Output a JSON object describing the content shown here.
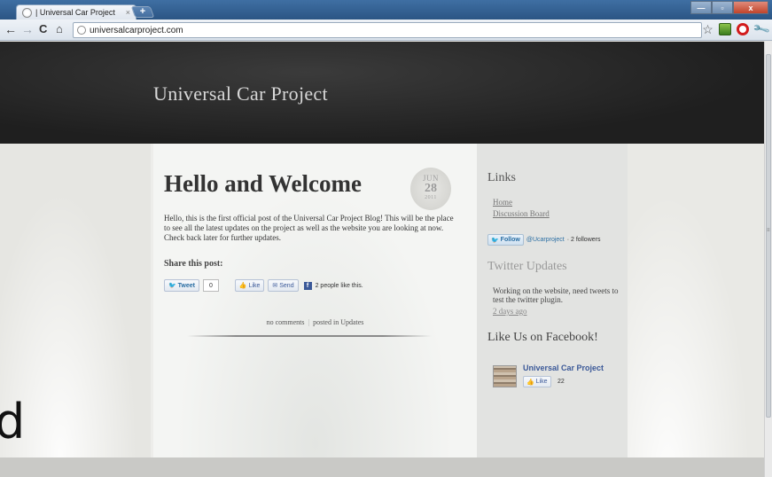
{
  "browser": {
    "tab_title": "| Universal Car Project",
    "tab_close": "×",
    "new_tab": "+",
    "url": "universalcarproject.com",
    "controls": {
      "back": "←",
      "forward": "→",
      "reload": "C",
      "home": "⌂",
      "star": "☆",
      "wrench": "🔧",
      "minimize": "—",
      "maximize": "▫",
      "close": "x"
    }
  },
  "site": {
    "title": "Universal Car Project"
  },
  "post": {
    "title": "Hello and Welcome",
    "date": {
      "month": "JUN",
      "day": "28",
      "year": "2011"
    },
    "body": "Hello, this is the first official post of the Universal Car Project Blog!  This will be the place to see all the latest updates on the project as well as the website you are looking at now.  Check back later for further updates.",
    "share_label": "Share this post:",
    "share": {
      "tweet_label": "Tweet",
      "tweet_count": "0",
      "like_label": "Like",
      "send_label": "Send",
      "fb_icon": "f",
      "likes_text": "2 people like this."
    },
    "meta": {
      "comments": "no comments",
      "separator": "|",
      "posted_in": "posted in",
      "category": "Updates"
    }
  },
  "sidebar": {
    "links_heading": "Links",
    "links": [
      "Home",
      "Discussion Board"
    ],
    "follow": {
      "button_label": "Follow",
      "handle": "@Ucarproject",
      "count": "· 2 followers"
    },
    "twitter_heading": "Twitter Updates",
    "tweet": {
      "text": "Working on the website, need tweets to test the twitter plugin.",
      "time": "2 days ago"
    },
    "facebook_heading": "Like Us on Facebook!",
    "facebook": {
      "page_name": "Universal Car Project",
      "like_label": "Like",
      "like_count": "22"
    }
  },
  "stray_glyph": "d",
  "colors": {
    "header_bg": "#1f1f1f",
    "page_bg": "#ededea",
    "link_blue": "#3b5998",
    "twitter_blue": "#2a6ea3"
  }
}
